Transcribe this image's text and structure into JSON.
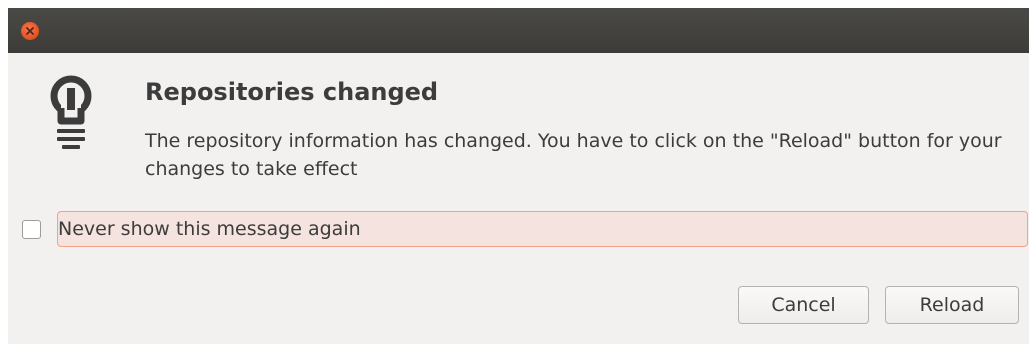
{
  "window": {
    "close_icon": "close-icon"
  },
  "dialog": {
    "icon": "lightbulb-icon",
    "title": "Repositories changed",
    "message": "The repository information has changed. You have to click on the \"Reload\" button for your changes to take effect",
    "checkbox": {
      "label": "Never show this message again",
      "checked": false
    },
    "buttons": {
      "cancel_label": "Cancel",
      "reload_label": "Reload"
    }
  },
  "colors": {
    "titlebar": "#3d3c39",
    "close_button": "#e95420",
    "dialog_background": "#f2f1f0",
    "focus_highlight": "#f0a389",
    "text": "#3c3c3c"
  }
}
